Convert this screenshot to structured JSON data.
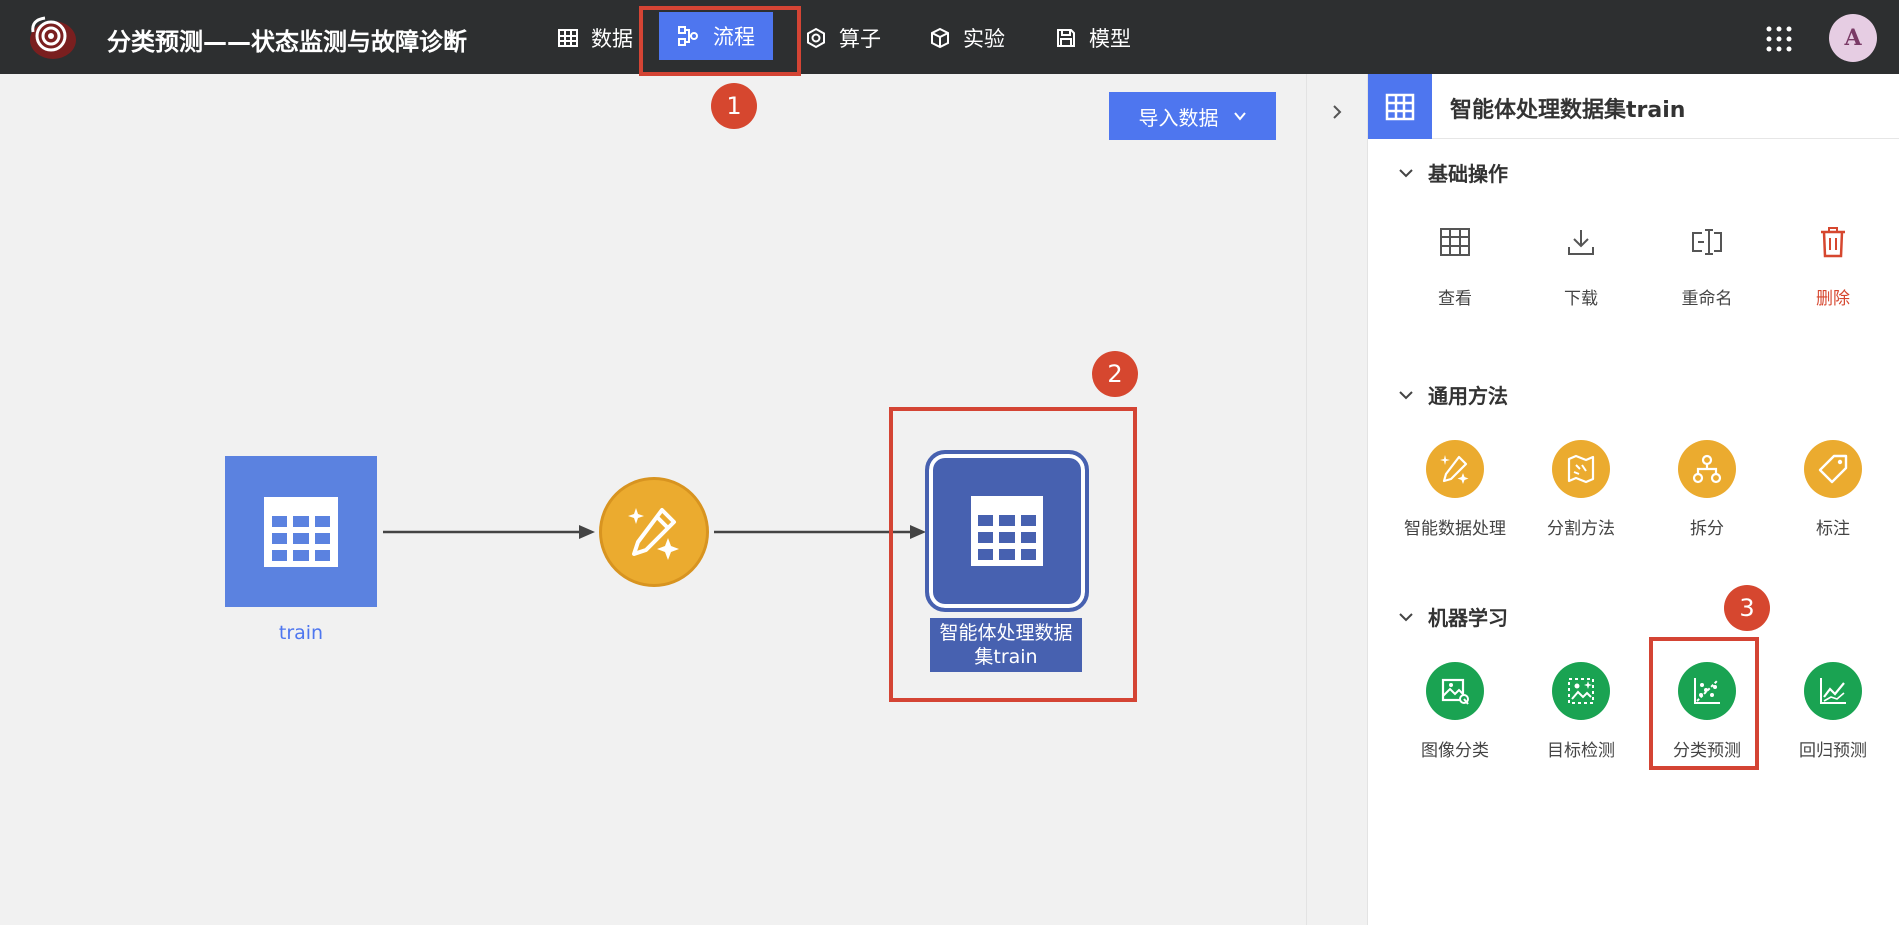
{
  "header": {
    "title": "分类预测——状态监测与故障诊断",
    "nav": [
      {
        "label": "数据",
        "icon": "table-icon"
      },
      {
        "label": "流程",
        "icon": "flow-icon",
        "active": true
      },
      {
        "label": "算子",
        "icon": "hexagon-icon"
      },
      {
        "label": "实验",
        "icon": "cube-icon"
      },
      {
        "label": "模型",
        "icon": "save-icon"
      }
    ],
    "avatar_letter": "A"
  },
  "canvas": {
    "import_button": "导入数据",
    "nodes": {
      "train": "train",
      "dataset": "智能体处理数据集train"
    }
  },
  "annotations": {
    "badges": [
      "1",
      "2",
      "3"
    ],
    "color": "#d6472f"
  },
  "panel": {
    "title": "智能体处理数据集train",
    "sections": {
      "basic": {
        "title": "基础操作",
        "items": [
          "查看",
          "下载",
          "重命名",
          "删除"
        ]
      },
      "general": {
        "title": "通用方法",
        "items": [
          "智能数据处理",
          "分割方法",
          "拆分",
          "标注"
        ]
      },
      "ml": {
        "title": "机器学习",
        "items": [
          "图像分类",
          "目标检测",
          "分类预测",
          "回归预测"
        ]
      }
    }
  },
  "colors": {
    "accent": "#4e76ef",
    "topbar": "#2d2f30",
    "orange": "#ebab2f",
    "green": "#1aa352",
    "node_dark": "#4761b0",
    "danger": "#d6472f"
  }
}
